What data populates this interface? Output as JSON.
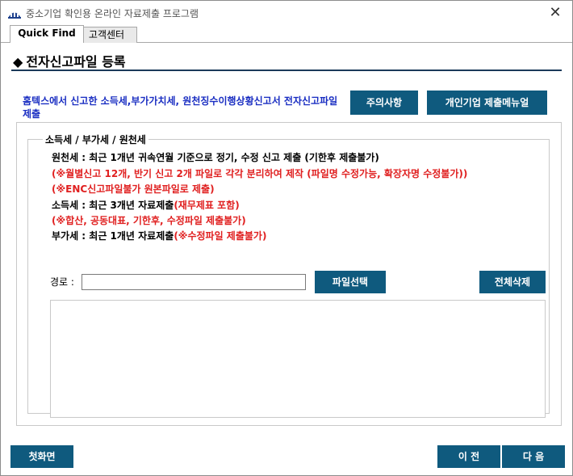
{
  "window": {
    "title": "중소기업 확인용 온라인 자료제출 프로그램",
    "close_glyph": "✕"
  },
  "tabs": [
    {
      "label": "Quick Find",
      "active": true
    },
    {
      "label": "고객센터",
      "active": false
    }
  ],
  "section": {
    "diamond": "◆",
    "title": "전자신고파일 등록"
  },
  "notice": {
    "text": "홈텍스에서 신고한 소득세,부가가치세, 원천징수이행상황신고서 전자신고파일 제출"
  },
  "buttons": {
    "caution": "주의사항",
    "personal_manual": "개인기업 제출메뉴얼",
    "file_select": "파일선택",
    "delete_all": "전체삭제",
    "home": "첫화면",
    "prev": "이 전",
    "next": "다 음"
  },
  "group": {
    "legend": "소득세 / 부가세 / 원천세",
    "lines": {
      "wonchun": "원천세 : 최근 1개년 귀속연월 기준으로 정기, 수정 신고 제출 (기한후 제출불가)",
      "wonchun_note1": "(※월별신고 12개, 반기 신고 2개 파일로 각각 분리하여 제작 (파일명 수정가능, 확장자명 수정불가))",
      "wonchun_note2": "(※ENC신고파일불가 원본파일로 제출)",
      "income_main": "소득세 : 최근 3개년 자료제출",
      "income_red": "(재무제표 포함)",
      "income_note": "(※합산, 공동대표, 기한후, 수정파일 제출불가)",
      "vat_main": "부가세 : 최근 1개년 자료제출",
      "vat_red": "(※수정파일 제출불가)"
    },
    "path_label": "경로 :",
    "path_value": ""
  },
  "colors": {
    "button_bg": "#0f5a7e",
    "notice_text": "#1a2ec2",
    "warning_text": "#e02020"
  },
  "icons": {
    "app": "blue-dome-app-icon",
    "close": "close-icon"
  }
}
